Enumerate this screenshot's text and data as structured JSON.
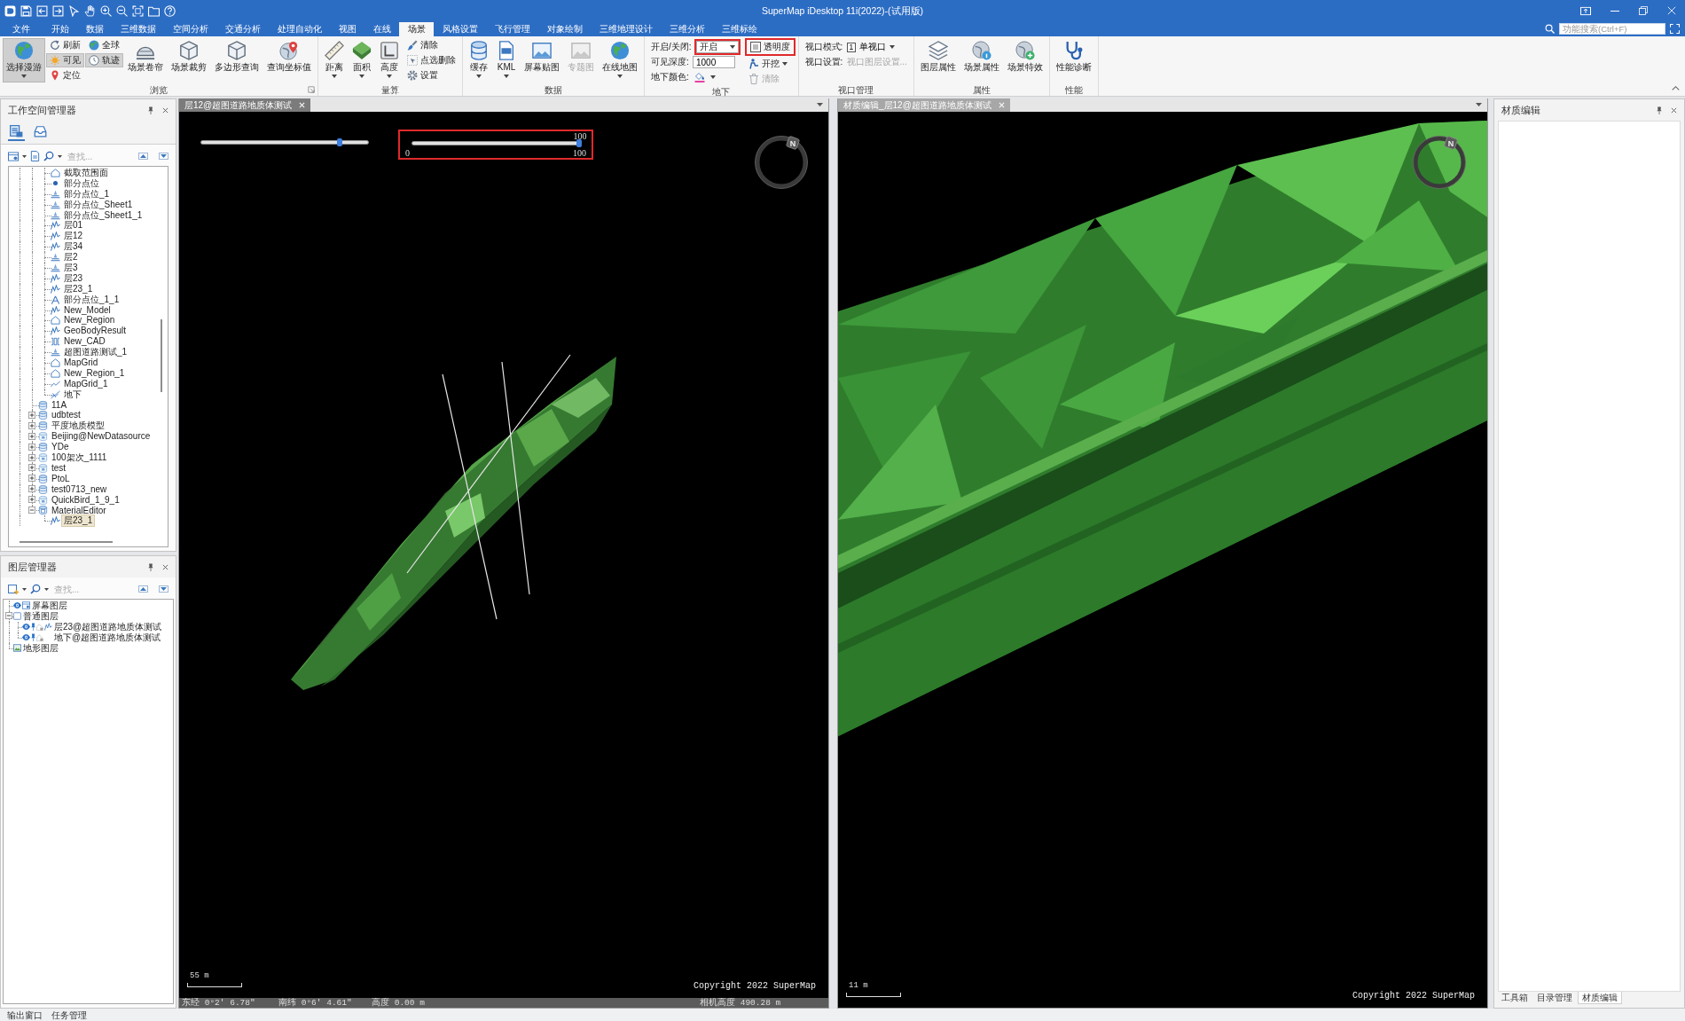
{
  "window": {
    "title": "SuperMap iDesktop 11i(2022)-(试用版)"
  },
  "menu_tabs": [
    {
      "label": "文件",
      "selected": false
    },
    {
      "label": "开始",
      "selected": false
    },
    {
      "label": "数据",
      "selected": false
    },
    {
      "label": "三维数据",
      "selected": false
    },
    {
      "label": "空间分析",
      "selected": false
    },
    {
      "label": "交通分析",
      "selected": false
    },
    {
      "label": "处理自动化",
      "selected": false
    },
    {
      "label": "视图",
      "selected": false
    },
    {
      "label": "在线",
      "selected": false
    },
    {
      "label": "场景",
      "selected": true
    },
    {
      "label": "风格设置",
      "selected": false
    },
    {
      "label": "飞行管理",
      "selected": false
    },
    {
      "label": "对象绘制",
      "selected": false
    },
    {
      "label": "三维地理设计",
      "selected": false
    },
    {
      "label": "三维分析",
      "selected": false
    },
    {
      "label": "三维标绘",
      "selected": false
    }
  ],
  "search": {
    "placeholder": "功能搜索(Ctrl+F)"
  },
  "ribbon": {
    "groups": [
      {
        "label": "浏览",
        "launcher": true,
        "columns": [
          {
            "kind": "large",
            "items": [
              {
                "label": "选择漫游",
                "on": true,
                "dropdown": true
              }
            ]
          },
          {
            "kind": "stack",
            "items": [
              {
                "label": "刷新",
                "on": false
              },
              {
                "label": "可见",
                "on": true
              },
              {
                "label": "定位",
                "on": false
              }
            ]
          },
          {
            "kind": "stack",
            "items": [
              {
                "label": "全球",
                "on": false
              },
              {
                "label": "轨迹",
                "on": true
              }
            ]
          },
          {
            "kind": "large",
            "items": [
              {
                "label": "场景卷帘",
                "on": false
              }
            ]
          },
          {
            "kind": "large",
            "items": [
              {
                "label": "场景裁剪",
                "on": false
              }
            ]
          },
          {
            "kind": "large",
            "items": [
              {
                "label": "多边形查询",
                "on": false
              }
            ]
          },
          {
            "kind": "large",
            "items": [
              {
                "label": "查询坐标值",
                "on": false
              }
            ]
          }
        ]
      },
      {
        "label": "量算",
        "columns": [
          {
            "kind": "large",
            "items": [
              {
                "label": "距离",
                "dropdown": true
              }
            ]
          },
          {
            "kind": "large",
            "items": [
              {
                "label": "面积",
                "dropdown": true
              }
            ]
          },
          {
            "kind": "large",
            "items": [
              {
                "label": "高度",
                "dropdown": true
              }
            ]
          },
          {
            "kind": "stack",
            "items": [
              {
                "label": "清除"
              },
              {
                "label": "点选删除"
              },
              {
                "label": "设置"
              }
            ]
          }
        ]
      },
      {
        "label": "数据",
        "columns": [
          {
            "kind": "large",
            "items": [
              {
                "label": "缓存",
                "dropdown": true
              }
            ]
          },
          {
            "kind": "large",
            "items": [
              {
                "label": "KML",
                "dropdown": true
              }
            ]
          },
          {
            "kind": "large",
            "items": [
              {
                "label": "屏幕贴图"
              }
            ]
          },
          {
            "kind": "large",
            "items": [
              {
                "label": "专题图",
                "disabled": true
              }
            ]
          },
          {
            "kind": "large",
            "items": [
              {
                "label": "在线地图",
                "dropdown": true
              }
            ]
          }
        ]
      },
      {
        "label": "地下",
        "columns": [
          {
            "kind": "fields",
            "items": [
              {
                "label": "开启/关闭:",
                "kind": "dropdown",
                "value": "开启",
                "highlighted": true
              },
              {
                "label": "可见深度:",
                "kind": "input",
                "value": "1000"
              },
              {
                "label": "地下颜色:",
                "kind": "color"
              }
            ]
          },
          {
            "kind": "stack",
            "items": [
              {
                "label": "透明度",
                "highlighted": true
              },
              {
                "label": "开挖",
                "dropdown": true
              },
              {
                "label": "清除",
                "disabled": true
              }
            ]
          }
        ]
      },
      {
        "label": "视口管理",
        "columns": [
          {
            "kind": "fields",
            "items": [
              {
                "label": "视口模式:",
                "kind": "mode",
                "number": "1",
                "value": "单视口"
              },
              {
                "label": "视口设置:",
                "kind": "link",
                "value": "视口图层设置...",
                "disabled": true
              }
            ]
          }
        ]
      },
      {
        "label": "属性",
        "columns": [
          {
            "kind": "large",
            "items": [
              {
                "label": "图层属性"
              }
            ]
          },
          {
            "kind": "large",
            "items": [
              {
                "label": "场景属性"
              }
            ]
          },
          {
            "kind": "large",
            "items": [
              {
                "label": "场景特效"
              }
            ]
          }
        ]
      },
      {
        "label": "性能",
        "columns": [
          {
            "kind": "large",
            "items": [
              {
                "label": "性能诊断"
              }
            ]
          }
        ]
      }
    ]
  },
  "workspace_panel": {
    "title": "工作空间管理器",
    "tabs": [
      {
        "selected": true
      },
      {
        "selected": false
      }
    ],
    "search": {
      "placeholder": "查找..."
    },
    "tree": [
      {
        "children": [
          {
            "label": "截取范围面",
            "kind": "region",
            "selected": false
          },
          {
            "label": "部分点位",
            "kind": "point",
            "selected": false
          },
          {
            "label": "部分点位_1",
            "kind": "point3d",
            "selected": false
          },
          {
            "label": "部分点位_Sheet1",
            "kind": "point3d",
            "selected": false
          },
          {
            "label": "部分点位_Sheet1_1",
            "kind": "point3d",
            "selected": false
          },
          {
            "label": "层01",
            "kind": "model",
            "selected": false
          },
          {
            "label": "层12",
            "kind": "model",
            "selected": false
          },
          {
            "label": "层34",
            "kind": "model",
            "selected": false
          },
          {
            "label": "层2",
            "kind": "point3d",
            "selected": false
          },
          {
            "label": "层3",
            "kind": "point3d",
            "selected": false
          },
          {
            "label": "层23",
            "kind": "model",
            "selected": false
          },
          {
            "label": "层23_1",
            "kind": "model",
            "selected": false
          },
          {
            "label": "部分点位_1_1",
            "kind": "text",
            "selected": false
          },
          {
            "label": "New_Model",
            "kind": "model",
            "selected": false
          },
          {
            "label": "New_Region",
            "kind": "region",
            "selected": false
          },
          {
            "label": "GeoBodyResult",
            "kind": "model",
            "selected": false
          },
          {
            "label": "New_CAD",
            "kind": "cad",
            "selected": false
          },
          {
            "label": "超图道路测试_1",
            "kind": "point3d",
            "selected": false
          },
          {
            "label": "MapGrid",
            "kind": "region",
            "selected": false
          },
          {
            "label": "New_Region_1",
            "kind": "region",
            "selected": false
          },
          {
            "label": "MapGrid_1",
            "kind": "line",
            "selected": false
          },
          {
            "label": "地下",
            "kind": "mesh",
            "selected": false
          }
        ]
      },
      {
        "label": "11A",
        "kind": "udb",
        "selected": false
      },
      {
        "label": "udbtest",
        "kind": "udb",
        "expanded": false,
        "selected": false
      },
      {
        "label": "平度地质模型",
        "kind": "udb",
        "expanded": false,
        "selected": false
      },
      {
        "label": "Beijing@NewDatasource",
        "kind": "image",
        "expanded": false,
        "selected": false
      },
      {
        "label": "YDe",
        "kind": "udb",
        "expanded": false,
        "selected": false
      },
      {
        "label": "100架次_1111",
        "kind": "image",
        "expanded": false,
        "selected": false
      },
      {
        "label": "test",
        "kind": "image",
        "expanded": false,
        "selected": false
      },
      {
        "label": "PtoL",
        "kind": "udb",
        "expanded": false,
        "selected": false
      },
      {
        "label": "test0713_new",
        "kind": "udb",
        "expanded": false,
        "selected": false
      },
      {
        "label": "QuickBird_1_9_1",
        "kind": "image",
        "expanded": false,
        "selected": false
      },
      {
        "label": "MaterialEditor",
        "kind": "material",
        "expanded": true,
        "selected": false,
        "children": [
          {
            "label": "层23_1",
            "kind": "model",
            "selected": true
          }
        ]
      }
    ]
  },
  "layer_panel": {
    "title": "图层管理器",
    "search": {
      "placeholder": "查找..."
    },
    "tree": [
      {
        "label": "屏幕图层",
        "kind": "screen",
        "visible": true,
        "selected": false
      },
      {
        "label": "普通图层",
        "kind": "normal",
        "expanded": true,
        "selected": false,
        "children": [
          {
            "label": "层23@超图道路地质体测试",
            "kind": "model",
            "visible": true,
            "selectable": true,
            "editable": false,
            "selected": false
          },
          {
            "label": "地下@超图道路地质体测试",
            "visible": true,
            "selectable": true,
            "editable": false,
            "selected": false
          }
        ]
      },
      {
        "label": "地形图层",
        "kind": "terrain",
        "selected": false
      }
    ]
  },
  "viewports": [
    {
      "kind": "overview",
      "tab": {
        "label": "层12@超图道路地质体测试",
        "selected": true
      },
      "sliders": [
        {
          "level": 0.83
        },
        {
          "level": 1,
          "readout": "100",
          "min_label": "0",
          "max_label": "100",
          "highlighted": true
        }
      ],
      "compass": {
        "label": "N"
      },
      "scale": "55 m",
      "copyright": "Copyright 2022 SuperMap",
      "status": [
        "东经 0°2' 6.78\"",
        "南纬 0°6' 4.61\"",
        "高度 0.00 m",
        "相机高度 490.28 m"
      ]
    },
    {
      "kind": "closeup",
      "tab": {
        "label": "材质编辑_层12@超图道路地质体测试",
        "selected": false
      },
      "compass": {
        "label": "N"
      },
      "scale": "11 m",
      "copyright": "Copyright 2022 SuperMap"
    }
  ],
  "right_panel": {
    "title": "材质编辑",
    "tabs": [
      {
        "label": "工具箱",
        "selected": false
      },
      {
        "label": "目录管理",
        "selected": false
      },
      {
        "label": "材质编辑",
        "selected": true
      }
    ]
  },
  "bottom_tabs": [
    {
      "label": "输出窗口",
      "selected": false
    },
    {
      "label": "任务管理",
      "selected": false
    }
  ]
}
